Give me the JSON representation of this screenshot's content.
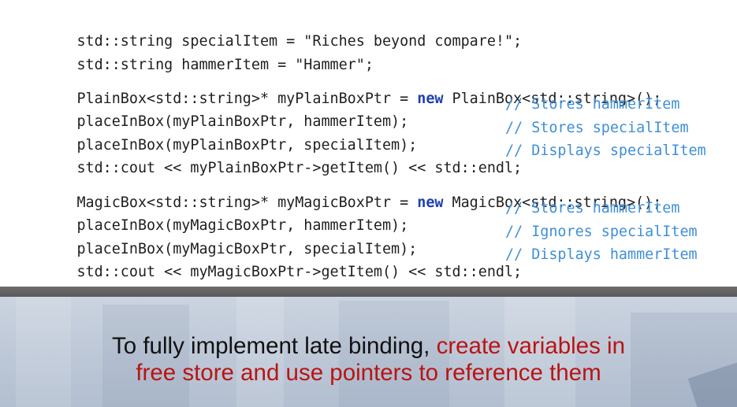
{
  "code": {
    "lines": [
      {
        "text": "std::string specialItem = \"Riches beyond compare!\";",
        "comment": ""
      },
      {
        "text": "std::string hammerItem = \"Hammer\";",
        "comment": ""
      },
      {
        "pre": "PlainBox<std::string>* myPlainBoxPtr = ",
        "kw": "new",
        "post": " PlainBox<std::string>();",
        "comment": ""
      },
      {
        "text": "placeInBox(myPlainBoxPtr, hammerItem);",
        "comment": "// Stores hammerItem"
      },
      {
        "text": "placeInBox(myPlainBoxPtr, specialItem);",
        "comment": "// Stores specialItem"
      },
      {
        "text": "std::cout << myPlainBoxPtr->getItem() << std::endl;",
        "comment": "// Displays specialItem"
      },
      {
        "pre": "MagicBox<std::string>* myMagicBoxPtr = ",
        "kw": "new",
        "post": " MagicBox<std::string>();",
        "comment": ""
      },
      {
        "text": "placeInBox(myMagicBoxPtr, hammerItem);",
        "comment": "// Stores hammerItem"
      },
      {
        "text": "placeInBox(myMagicBoxPtr, specialItem);",
        "comment": "// Ignores specialItem"
      },
      {
        "text": "std::cout << myMagicBoxPtr->getItem() << std::endl;",
        "comment": "// Displays hammerItem"
      }
    ]
  },
  "caption": {
    "plain": "To fully implement late binding, ",
    "highlight_line1": "create variables in",
    "highlight_line2": "free store and use pointers to reference them"
  },
  "colors": {
    "keyword": "#1f3fb0",
    "comment": "#3f8fd8",
    "highlight": "#b81414"
  }
}
